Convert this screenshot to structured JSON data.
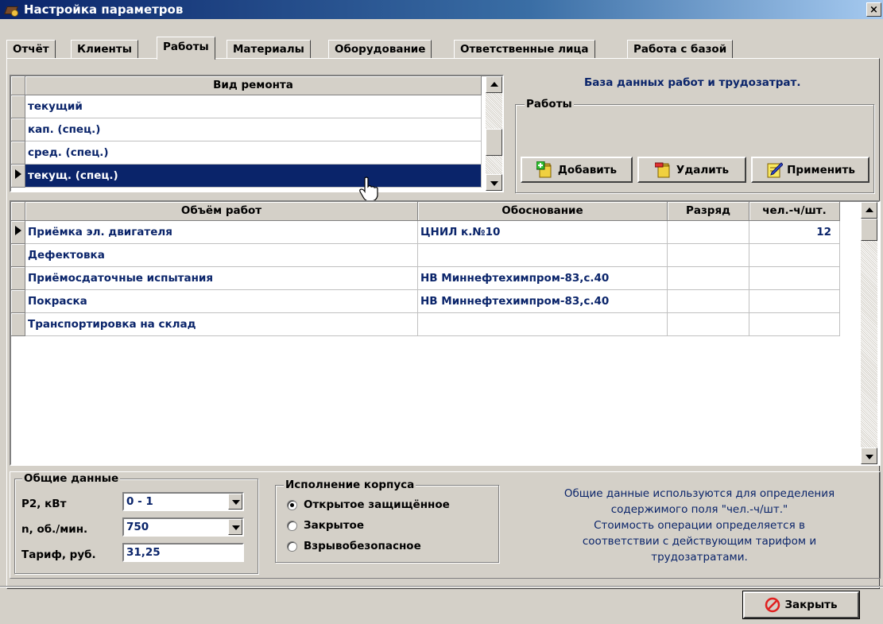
{
  "window": {
    "title": "Настройка параметров",
    "close": "×"
  },
  "tabs": [
    "Отчёт",
    "Клиенты",
    "Работы",
    "Материалы",
    "Оборудование",
    "Ответственные лица",
    "Работа с базой"
  ],
  "repair": {
    "header": "Вид ремонта",
    "rows": [
      "текущий",
      "кап. (спец.)",
      "сред. (спец.)",
      "текущ. (спец.)"
    ]
  },
  "db_title": "База данных работ и трудозатрат.",
  "works_group": {
    "label": "Работы",
    "add": "Добавить",
    "delete": "Удалить",
    "apply": "Применить"
  },
  "works_table": {
    "headers": [
      "Объём работ",
      "Обоснование",
      "Разряд",
      "чел.-ч/шт."
    ],
    "rows": [
      {
        "name": "Приёмка эл. двигателя",
        "basis": "ЦНИЛ к.№10",
        "grade": "",
        "hours": "12"
      },
      {
        "name": "Дефектовка",
        "basis": "",
        "grade": "",
        "hours": ""
      },
      {
        "name": "Приёмосдаточные испытания",
        "basis": "НВ Миннефтехимпром-83,с.40",
        "grade": "",
        "hours": ""
      },
      {
        "name": "Покраска",
        "basis": "НВ Миннефтехимпром-83,с.40",
        "grade": "",
        "hours": ""
      },
      {
        "name": "Транспортировка на склад",
        "basis": "",
        "grade": "",
        "hours": ""
      }
    ]
  },
  "general": {
    "label": "Общие данные",
    "p2_label": "Р2, кВт",
    "p2_value": "0 - 1",
    "n_label": "n, об./мин.",
    "n_value": "750",
    "tariff_label": "Тариф, руб.",
    "tariff_value": "31,25"
  },
  "housing": {
    "label": "Исполнение корпуса",
    "options": [
      "Открытое защищённое",
      "Закрытое",
      "Взрывобезопасное"
    ],
    "selected": 0
  },
  "info_lines": [
    "Общие данные используются для определения",
    "содержимого поля \"чел.-ч/шт.\"",
    "Стоимость операции определяется в",
    "соответствии с действующим тарифом и",
    "трудозатратами."
  ],
  "close_button": "Закрыть"
}
